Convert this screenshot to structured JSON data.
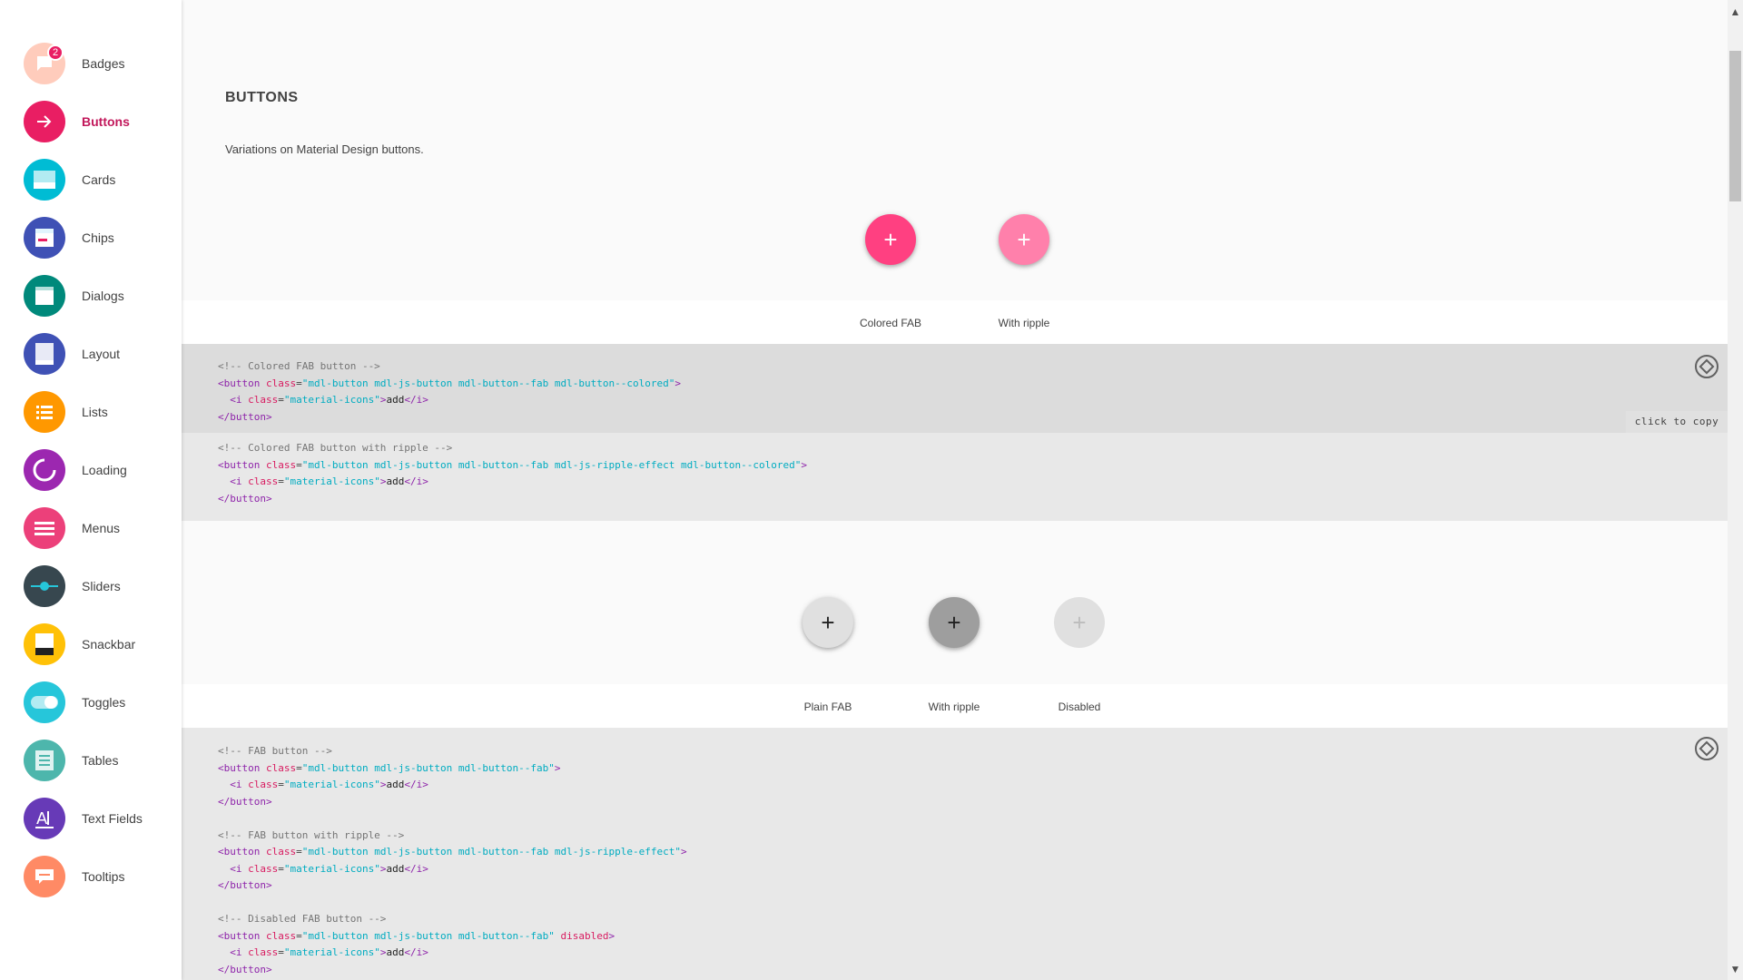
{
  "sidebar": {
    "items": [
      {
        "label": "Badges",
        "icon": "badge-icon",
        "color": "#ffccbc",
        "badge": "2"
      },
      {
        "label": "Buttons",
        "icon": "arrow-forward-icon",
        "color": "#e91e63",
        "active": true
      },
      {
        "label": "Cards",
        "icon": "card-icon",
        "color": "#00bcd4"
      },
      {
        "label": "Chips",
        "icon": "chip-icon",
        "color": "#3f51b5"
      },
      {
        "label": "Dialogs",
        "icon": "dialog-icon",
        "color": "#00897b"
      },
      {
        "label": "Layout",
        "icon": "layout-icon",
        "color": "#3f51b5"
      },
      {
        "label": "Lists",
        "icon": "list-icon",
        "color": "#ff9800"
      },
      {
        "label": "Loading",
        "icon": "loading-icon",
        "color": "#9c27b0"
      },
      {
        "label": "Menus",
        "icon": "menu-icon",
        "color": "#ec407a"
      },
      {
        "label": "Sliders",
        "icon": "slider-icon",
        "color": "#37474f"
      },
      {
        "label": "Snackbar",
        "icon": "snackbar-icon",
        "color": "#ffc107"
      },
      {
        "label": "Toggles",
        "icon": "toggle-icon",
        "color": "#26c6da"
      },
      {
        "label": "Tables",
        "icon": "table-icon",
        "color": "#4db6ac"
      },
      {
        "label": "Text Fields",
        "icon": "text-field-icon",
        "color": "#673ab7"
      },
      {
        "label": "Tooltips",
        "icon": "tooltip-icon",
        "color": "#ff8a65"
      }
    ]
  },
  "main": {
    "title": "BUTTONS",
    "description": "Variations on Material Design buttons.",
    "demo1": {
      "buttons": [
        {
          "glyph": "+",
          "caption": "Colored FAB"
        },
        {
          "glyph": "+",
          "caption": "With ripple"
        }
      ]
    },
    "code1": {
      "block_a": {
        "comment": "<!-- Colored FAB button -->",
        "open_tag": "<button",
        "class_attr": "class",
        "class_val": "\"mdl-button mdl-js-button mdl-button--fab mdl-button--colored\"",
        "i_open": "<i",
        "i_class_val": "\"material-icons\"",
        "i_text": "add",
        "i_close": "</i>",
        "close_tag": "</button>"
      },
      "block_b": {
        "comment": "<!-- Colored FAB button with ripple -->",
        "class_val": "\"mdl-button mdl-js-button mdl-button--fab mdl-js-ripple-effect mdl-button--colored\""
      },
      "copy_label": "click to copy"
    },
    "demo2": {
      "buttons": [
        {
          "glyph": "+",
          "caption": "Plain FAB"
        },
        {
          "glyph": "+",
          "caption": "With ripple"
        },
        {
          "glyph": "+",
          "caption": "Disabled"
        }
      ]
    },
    "code2": {
      "block_a": {
        "comment": "<!-- FAB button -->",
        "class_val": "\"mdl-button mdl-js-button mdl-button--fab\""
      },
      "block_b": {
        "comment": "<!-- FAB button with ripple -->",
        "class_val": "\"mdl-button mdl-js-button mdl-button--fab mdl-js-ripple-effect\""
      },
      "block_c": {
        "comment": "<!-- Disabled FAB button -->",
        "class_val": "\"mdl-button mdl-js-button mdl-button--fab\"",
        "disabled_kw": "disabled"
      }
    }
  },
  "scrollbar": {
    "up": "▲",
    "down": "▼"
  }
}
